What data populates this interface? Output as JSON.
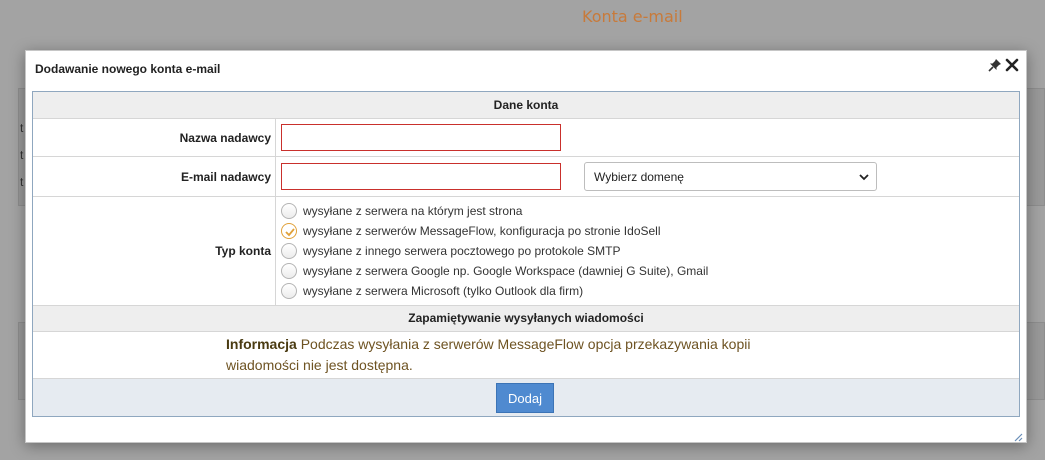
{
  "background": {
    "page_title": "Konta e-mail",
    "row_letters": [
      "t",
      "t",
      "t"
    ]
  },
  "dialog": {
    "title": "Dodawanie nowego konta e-mail",
    "icons": [
      "pin-icon",
      "close-icon"
    ],
    "section_account": "Dane konta",
    "sender_name_label": "Nazwa nadawcy",
    "sender_name_value": "",
    "sender_email_label": "E-mail nadawcy",
    "sender_email_value": "",
    "domain_select": {
      "selected": "Wybierz domenę"
    },
    "account_type_label": "Typ konta",
    "account_types": [
      {
        "label": "wysyłane z serwera na którym jest strona",
        "checked": false
      },
      {
        "label": "wysyłane z serwerów MessageFlow, konfiguracja po stronie IdoSell",
        "checked": true
      },
      {
        "label": "wysyłane z innego serwera pocztowego po protokole SMTP",
        "checked": false
      },
      {
        "label": "wysyłane z serwera Google np. Google Workspace (dawniej G Suite), Gmail",
        "checked": false
      },
      {
        "label": "wysyłane z serwera Microsoft (tylko Outlook dla firm)",
        "checked": false
      }
    ],
    "section_saving": "Zapamiętywanie wysyłanych wiadomości",
    "info_label": "Informacja",
    "info_text_line1": "Podczas wysyłania z serwerów MessageFlow opcja przekazywania kopii",
    "info_text_line2": "wiadomości nie jest dostępna.",
    "add_button": "Dodaj"
  },
  "colors": {
    "accent_title": "#c87a3a",
    "input_error_border": "#c9302c",
    "radio_checked": "#e0a13a",
    "button_primary": "#4f8ad0",
    "info_text": "#6e5322"
  }
}
